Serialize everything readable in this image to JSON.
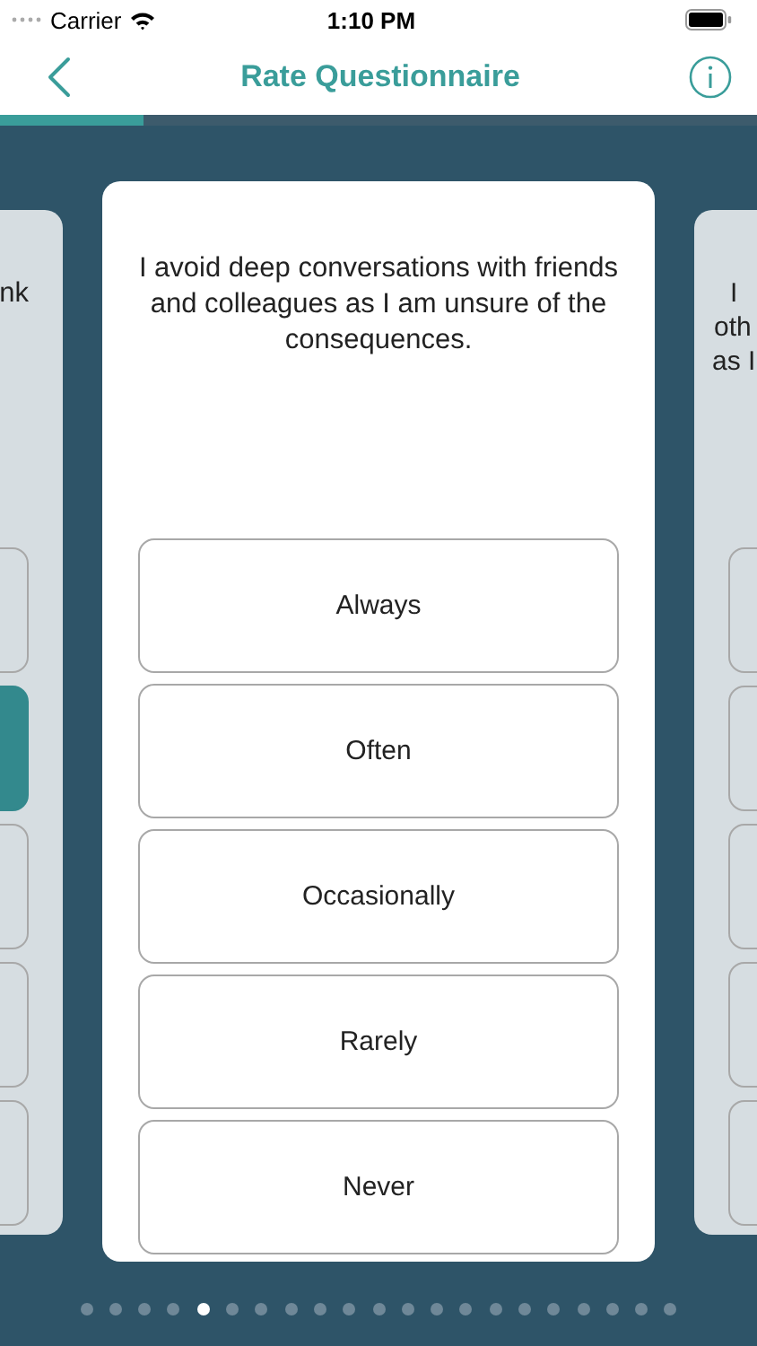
{
  "status_bar": {
    "carrier": "Carrier",
    "time": "1:10 PM"
  },
  "nav": {
    "title": "Rate Questionnaire"
  },
  "progress": {
    "level": 0.19
  },
  "cards": [
    {
      "kind": "previous",
      "lines": [
        "nk"
      ],
      "options": [
        {
          "selected": false
        },
        {
          "selected": true
        },
        {
          "selected": false
        },
        {
          "selected": false
        },
        {
          "selected": false
        }
      ]
    },
    {
      "kind": "current",
      "question": "I avoid deep conversations with friends and colleagues as I am unsure of the consequences.",
      "options": [
        {
          "label": "Always",
          "selected": false
        },
        {
          "label": "Often",
          "selected": false
        },
        {
          "label": "Occasionally",
          "selected": false
        },
        {
          "label": "Rarely",
          "selected": false
        },
        {
          "label": "Never",
          "selected": false
        }
      ]
    },
    {
      "kind": "next",
      "lines": [
        "I",
        "oth",
        "as I"
      ],
      "options": [
        {
          "selected": false
        },
        {
          "selected": false
        },
        {
          "selected": false
        },
        {
          "selected": false
        },
        {
          "selected": false
        }
      ]
    }
  ],
  "pager": [
    {
      "selected": false
    },
    {
      "selected": false
    },
    {
      "selected": false
    },
    {
      "selected": false
    },
    {
      "selected": true
    },
    {
      "selected": false
    },
    {
      "selected": false
    },
    {
      "selected": false
    },
    {
      "selected": false
    },
    {
      "selected": false
    },
    {
      "selected": false
    },
    {
      "selected": false
    },
    {
      "selected": false
    },
    {
      "selected": false
    },
    {
      "selected": false
    },
    {
      "selected": false
    },
    {
      "selected": false
    },
    {
      "selected": false
    },
    {
      "selected": false
    },
    {
      "selected": false
    },
    {
      "selected": false
    }
  ]
}
